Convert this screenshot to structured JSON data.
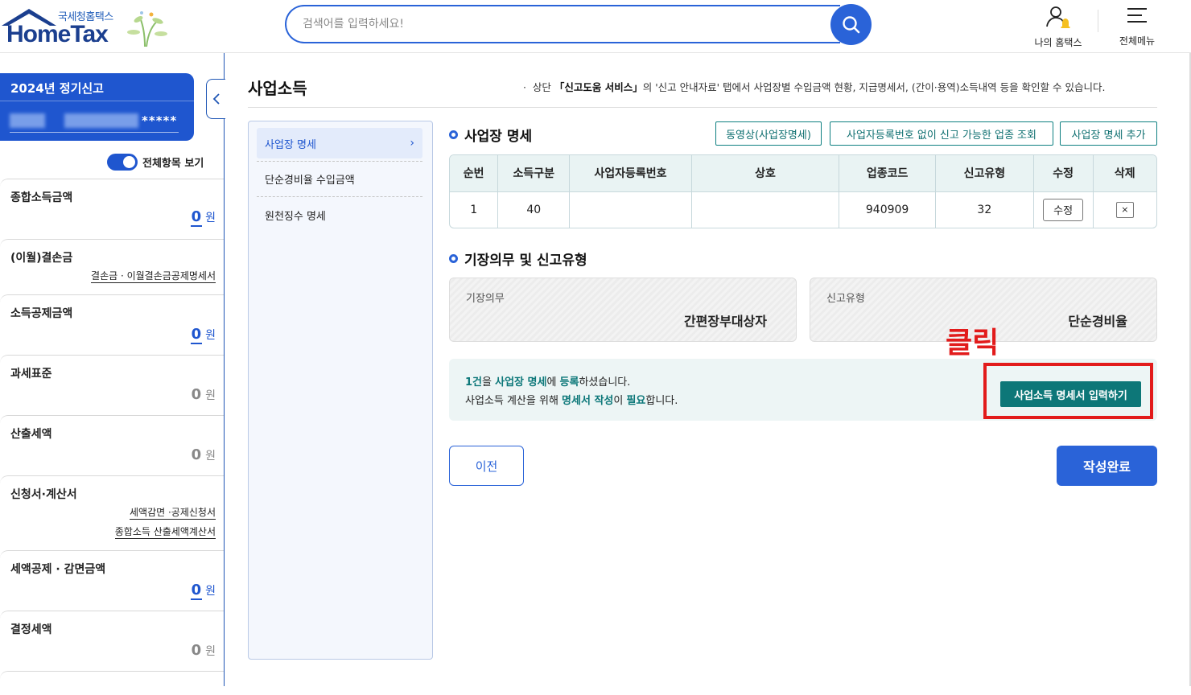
{
  "header": {
    "logo_small": "국세청홈택스",
    "logo_main": "HomeTax",
    "search_placeholder": "검색어를 입력하세요!",
    "my_hometax": "나의 홈택스",
    "all_menu": "전체메뉴"
  },
  "sidebar": {
    "year_title": "2024년 정기신고",
    "user_name_masked": "*****",
    "toggle_label": "전체항목 보기",
    "items": [
      {
        "title": "종합소득금액",
        "amount": "0",
        "unit": "원"
      },
      {
        "title": "(이월)결손금",
        "link": "결손금 · 이월결손금공제명세서"
      },
      {
        "title": "소득공제금액",
        "amount": "0",
        "unit": "원"
      },
      {
        "title": "과세표준",
        "amount": "0",
        "unit": "원"
      },
      {
        "title": "산출세액",
        "amount": "0",
        "unit": "원"
      },
      {
        "title": "신청서·계산서",
        "link1": "세액감면 ·공제신청서",
        "link2": "종합소득 산출세액계산서"
      },
      {
        "title": "세액공제 · 감면금액",
        "amount": "0",
        "unit": "원"
      },
      {
        "title": "결정세액",
        "amount": "0",
        "unit": "원"
      }
    ]
  },
  "main": {
    "title": "사업소득",
    "note_prefix": "상단 ",
    "note_bold": "「신고도움 서비스」",
    "note_suffix": "의 '신고 안내자료' 탭에서 사업장별 수입금액 현황, 지급명세서, (간이·용역)소득내역 등을 확인할 수 있습니다.",
    "subnav": [
      "사업장 명세",
      "단순경비율 수입금액",
      "원천징수 명세"
    ],
    "section1_title": "사업장 명세",
    "buttons": [
      "동영상(사업장명세)",
      "사업자등록번호 없이 신고 가능한 업종 조회",
      "사업장 명세 추가"
    ],
    "table": {
      "headers": [
        "순번",
        "소득구분",
        "사업자등록번호",
        "상호",
        "업종코드",
        "신고유형",
        "수정",
        "삭제"
      ],
      "rows": [
        {
          "seq": "1",
          "income_type": "40",
          "biz_no": "",
          "name": "",
          "industry_code": "940909",
          "report_type": "32",
          "edit": "수정",
          "delete": "×"
        }
      ]
    },
    "section2_title": "기장의무 및 신고유형",
    "bookkeeping_label": "기장의무",
    "bookkeeping_value": "간편장부대상자",
    "report_type_label": "신고유형",
    "report_type_value": "단순경비율",
    "notice": {
      "l1_a": "1건",
      "l1_b": "을 ",
      "l1_c": "사업장 명세",
      "l1_d": "에 ",
      "l1_e": "등록",
      "l1_f": "하셨습니다.",
      "l2_a": "사업소득 계산을 위해 ",
      "l2_b": "명세서 작성",
      "l2_c": "이 ",
      "l2_d": "필요",
      "l2_e": "합니다."
    },
    "click_annotation": "클릭",
    "enter_statement_button": "사업소득 명세서 입력하기",
    "prev_button": "이전",
    "complete_button": "작성완료"
  },
  "colors": {
    "brand_blue": "#2a63d8",
    "teal": "#0d7778",
    "annotation_red": "#e21b1b"
  }
}
